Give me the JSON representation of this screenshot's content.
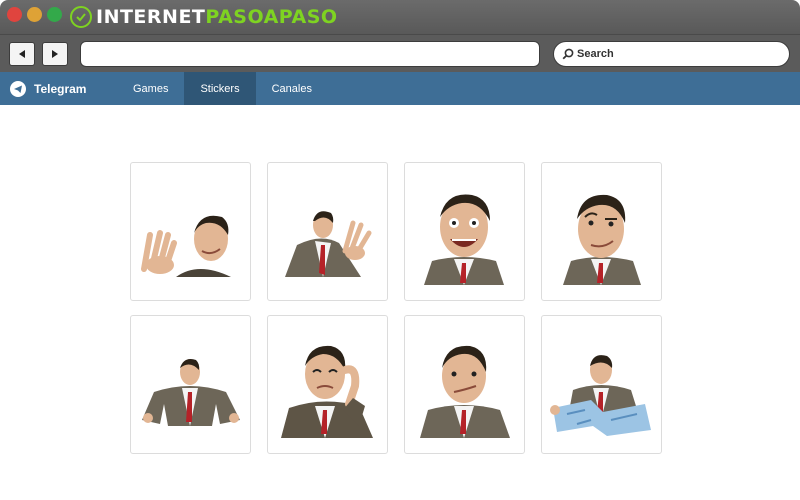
{
  "browser": {
    "brand_part1": "INTERNET",
    "brand_part2": "PASOAPASO",
    "address_value": "",
    "search_placeholder": "Search"
  },
  "telegram": {
    "title": "Telegram",
    "tabs": [
      {
        "label": "Games",
        "active": false
      },
      {
        "label": "Stickers",
        "active": true
      },
      {
        "label": "Canales",
        "active": false
      }
    ]
  },
  "colors": {
    "nav_bar": "#3e6e96",
    "nav_active": "#2f5676",
    "brand_accent": "#7ed321"
  },
  "stickers": [
    {
      "icon": "waving-man-sticker-icon"
    },
    {
      "icon": "waving-man-suit-sticker-icon"
    },
    {
      "icon": "grinning-face-sticker-icon"
    },
    {
      "icon": "raised-eyebrow-face-sticker-icon"
    },
    {
      "icon": "hands-on-hips-sticker-icon"
    },
    {
      "icon": "scratching-head-sticker-icon"
    },
    {
      "icon": "smirk-face-sticker-icon"
    },
    {
      "icon": "reading-map-sticker-icon"
    }
  ]
}
